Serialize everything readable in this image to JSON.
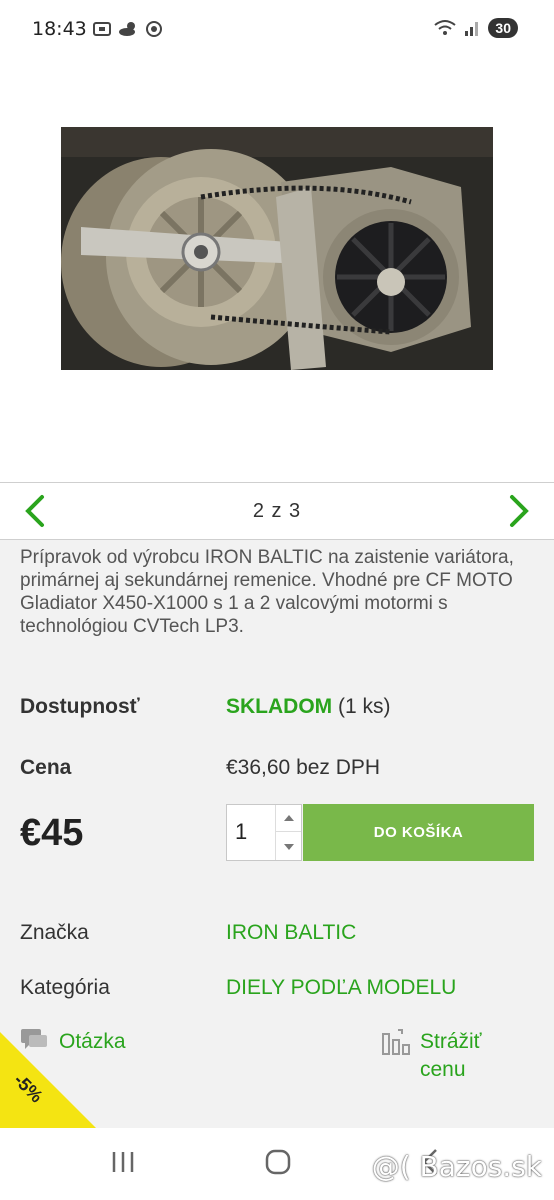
{
  "status_bar": {
    "time": "18:43",
    "battery": "30"
  },
  "pager": {
    "counter": "2 z 3"
  },
  "product": {
    "description": "Prípravok od výrobcu IRON BALTIC na zaistenie variátora, primárnej aj sekundárnej remenice. Vhodné pre CF MOTO Gladiator X450-X1000 s 1 a 2 valcovými motormi s technológiou CVTech LP3.",
    "availability_label": "Dostupnosť",
    "availability_status": "SKLADOM",
    "availability_count": "(1 ks)",
    "price_label": "Cena",
    "price_net": "€36,60 bez DPH",
    "price": "€45",
    "quantity": "1",
    "add_to_cart_label": "DO KOŠÍKA",
    "brand_label": "Značka",
    "brand_value": "IRON BALTIC",
    "category_label": "Kategória",
    "category_value": "DIELY PODĽA MODELU",
    "question_label": "Otázka",
    "watch_price_line1": "Strážiť",
    "watch_price_line2": "cenu",
    "discount": "-5%"
  },
  "watermark": "@( Bazos.sk",
  "colors": {
    "accent_green": "#2aa41d",
    "cart_button": "#79b84a",
    "discount_ribbon": "#f4e412"
  },
  "icons": [
    "cast-icon",
    "weather-icon",
    "chrome-icon",
    "wifi-icon",
    "signal-icon",
    "chevron-left-icon",
    "chevron-right-icon",
    "chat-icon",
    "chart-icon",
    "recents-icon",
    "home-icon",
    "back-icon"
  ]
}
